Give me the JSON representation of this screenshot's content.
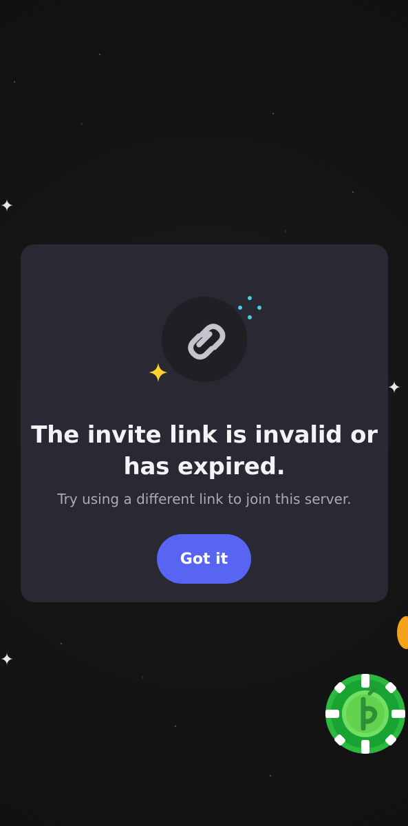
{
  "modal": {
    "title_line_1": "The invite link is invalid or",
    "title_line_2": "has expired.",
    "subtitle": "Try using a different link to join this server.",
    "button_label": "Got it",
    "icon": "link-icon",
    "accent": "#5865f2",
    "background": "#282932"
  },
  "decor": {
    "sparkle_colors": [
      "#ffd22e",
      "#47d0dd"
    ],
    "chip_icon": "green-poker-chip-icon",
    "coin_icon": "gold-coin-icon"
  }
}
